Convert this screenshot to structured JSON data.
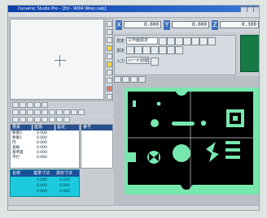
{
  "window": {
    "title": "Dynamic Studio Pro – [Ed - 9004 Wren.nab]"
  },
  "coords": {
    "x_label": "X",
    "x_value": "0.000",
    "y_label": "Y",
    "y_value": "0.000",
    "z_label": "Z",
    "z_value": "0.300"
  },
  "panel": {
    "row1_label": "測定",
    "mode_select": "工作面測定",
    "row2_label": "測定",
    "row3_label": "入力",
    "button_text": "ハード切替"
  },
  "table": {
    "headers": [
      "要素",
      "座標",
      "設定"
    ],
    "rows": [
      [
        "要素0",
        "0.000",
        ""
      ],
      [
        "要素1",
        "0.000",
        ""
      ],
      [
        "円",
        "0.000",
        ""
      ],
      [
        "直線",
        "0.000",
        ""
      ],
      [
        "基準面",
        "0.000",
        ""
      ],
      [
        "平行",
        "0.000",
        ""
      ]
    ]
  },
  "right_table": {
    "header": "番号"
  },
  "bottom_table": {
    "headers": [
      "名称",
      "基準寸法",
      "測定寸法"
    ],
    "rows": [
      [
        "",
        "0.000",
        "0.000"
      ],
      [
        "",
        "0.000",
        "0.000"
      ],
      [
        "",
        "0.000",
        "0.000"
      ]
    ]
  },
  "colors": {
    "accent": "#3d6fb6",
    "canvas_bg": "#77e8ad",
    "part_fill": "#000000",
    "green_status": "#157a45",
    "cyan_table": "#1bcbdd"
  }
}
